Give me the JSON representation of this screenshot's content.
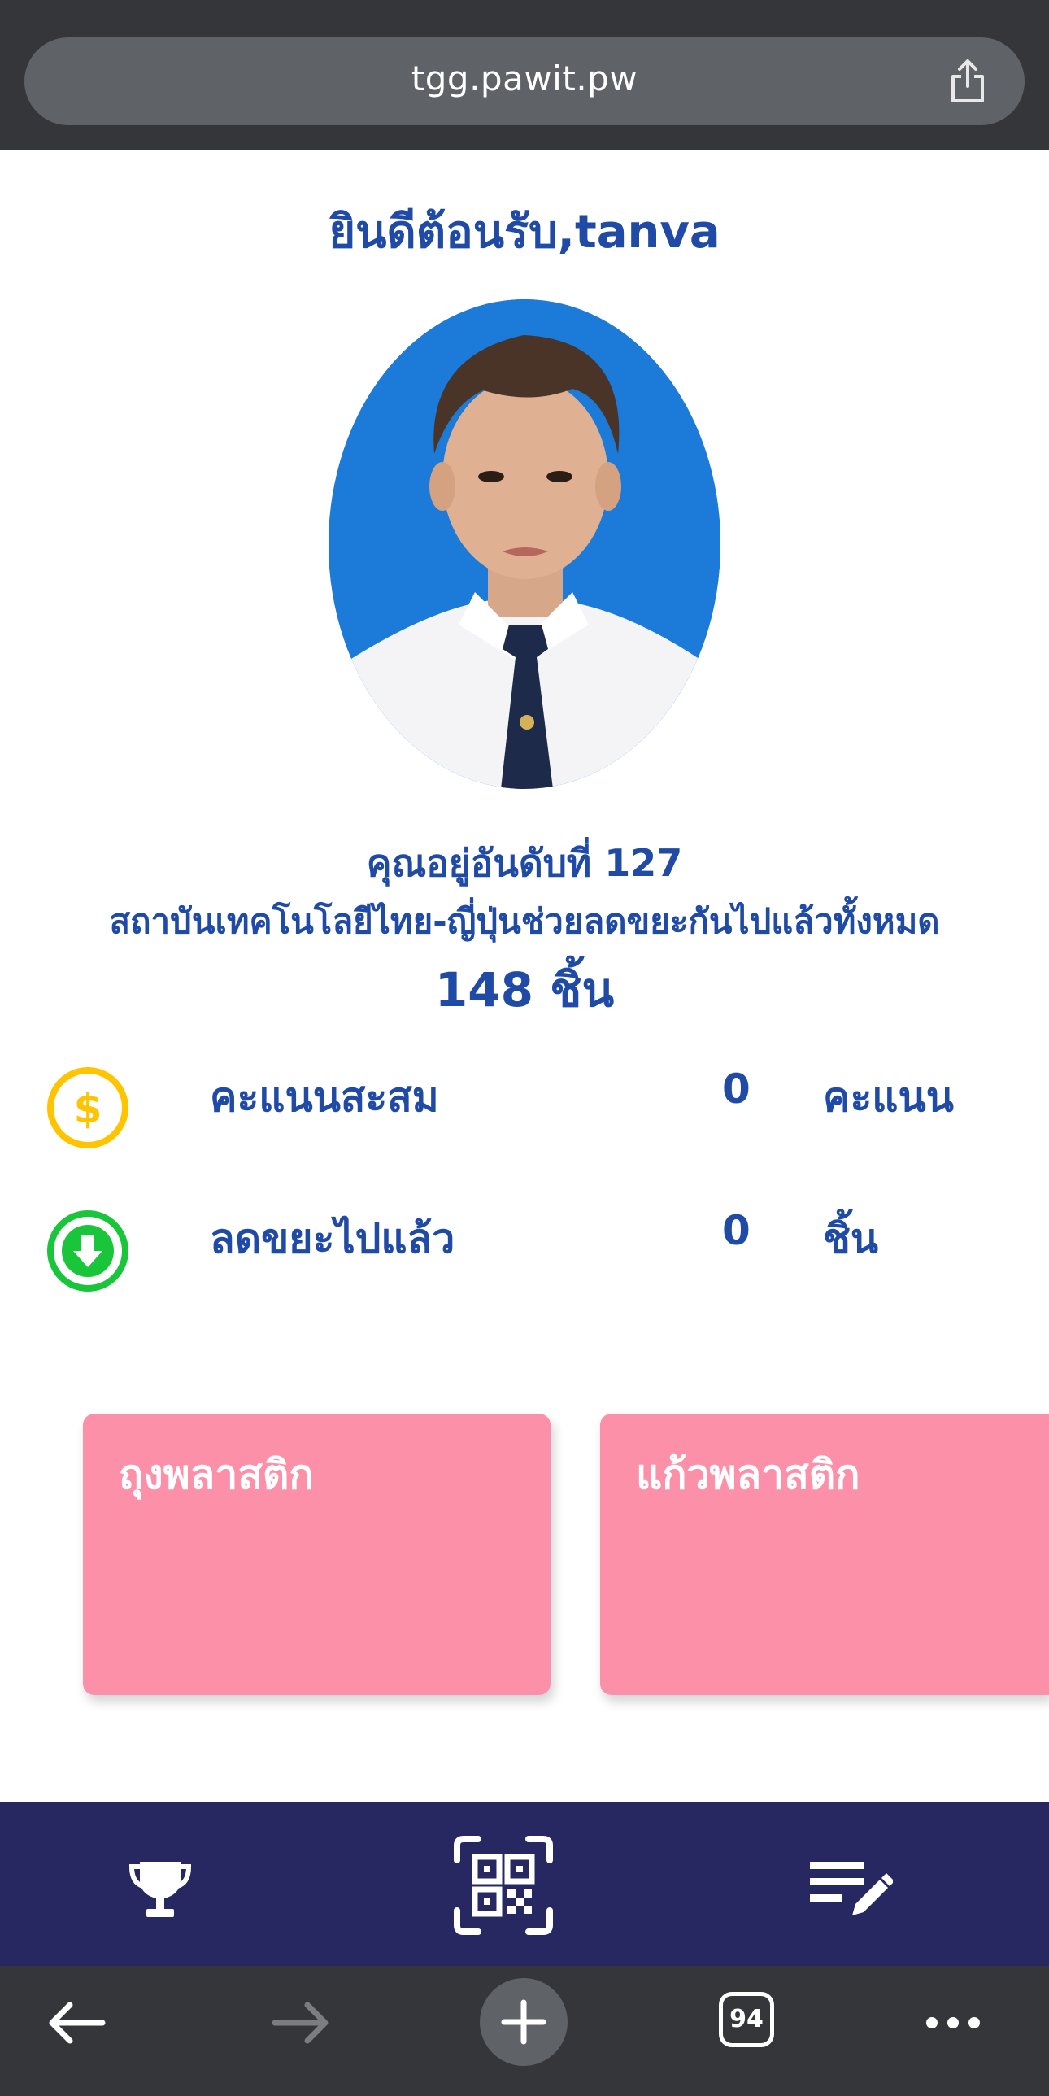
{
  "browser": {
    "url": "tgg.pawit.pw",
    "tab_count": "94"
  },
  "header": {
    "welcome": "ยินดีต้อนรับ,tanva"
  },
  "profile": {
    "rank_text": "คุณอยู่อันดับที่ 127",
    "institute_text": "สถาบันเทคโนโลยีไทย-ญี่ปุ่นช่วยลดขยะกันไปแล้วทั้งหมด",
    "total_text": "148 ชิ้น"
  },
  "stats": {
    "points": {
      "label": "คะแนนสะสม",
      "value": "0",
      "unit": "คะแนน",
      "icon": "dollar-coin-icon",
      "color": "#ffc400"
    },
    "reduced": {
      "label": "ลดขยะไปแล้ว",
      "value": "0",
      "unit": "ชิ้น",
      "icon": "download-arrow-icon",
      "color": "#19c63a"
    }
  },
  "cards": [
    {
      "title": "ถุงพลาสติก"
    },
    {
      "title": "แก้วพลาสติก"
    }
  ],
  "nav": {
    "items": [
      "trophy-icon",
      "qr-scan-icon",
      "edit-list-icon"
    ]
  },
  "colors": {
    "primary_text": "#1f4aa5",
    "card": "#fd90a9",
    "nav_bg": "#272862",
    "browser_bg": "#34363a"
  }
}
